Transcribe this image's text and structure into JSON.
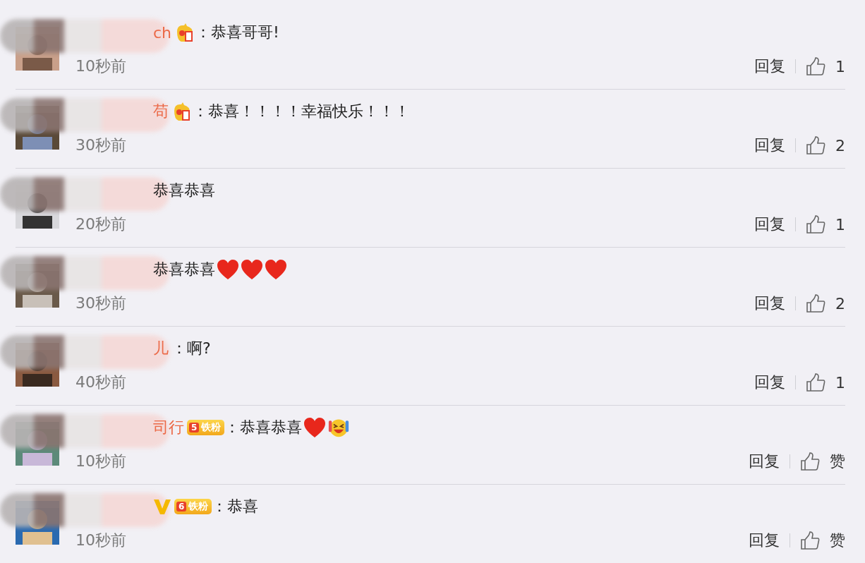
{
  "comments": [
    {
      "name": "ch",
      "badges": [
        {
          "kind": "crown"
        }
      ],
      "colon": "：",
      "text": "恭喜哥哥!",
      "time": "10秒前",
      "reply": "回复",
      "likes": "1"
    },
    {
      "name": "苟",
      "badges": [
        {
          "kind": "crown"
        }
      ],
      "colon": "：",
      "text": "恭喜！！！！幸福快乐！！！",
      "time": "30秒前",
      "reply": "回复",
      "likes": "2"
    },
    {
      "text": "恭喜恭喜",
      "time": "20秒前",
      "reply": "回复",
      "likes": "1"
    },
    {
      "text": "恭喜恭喜",
      "emojis": [
        {
          "kind": "heart"
        },
        {
          "kind": "heart"
        },
        {
          "kind": "heart"
        }
      ],
      "time": "30秒前",
      "reply": "回复",
      "likes": "2"
    },
    {
      "name": "儿",
      "colon": "：",
      "text": "啊?",
      "time": "40秒前",
      "reply": "回复",
      "likes": "1"
    },
    {
      "name": "司行",
      "badges": [
        {
          "kind": "fan",
          "level": "5",
          "label": "铁粉"
        }
      ],
      "colon": "：",
      "text": "恭喜恭喜",
      "emojis": [
        {
          "kind": "heart"
        },
        {
          "kind": "laugh-cry"
        }
      ],
      "time": "10秒前",
      "reply": "回复",
      "likes": "赞"
    },
    {
      "badges": [
        {
          "kind": "verified"
        },
        {
          "kind": "fan",
          "level": "6",
          "label": "铁粉"
        }
      ],
      "colon": "：",
      "text": "恭喜",
      "time": "10秒前",
      "reply": "回复",
      "likes": "赞"
    }
  ]
}
